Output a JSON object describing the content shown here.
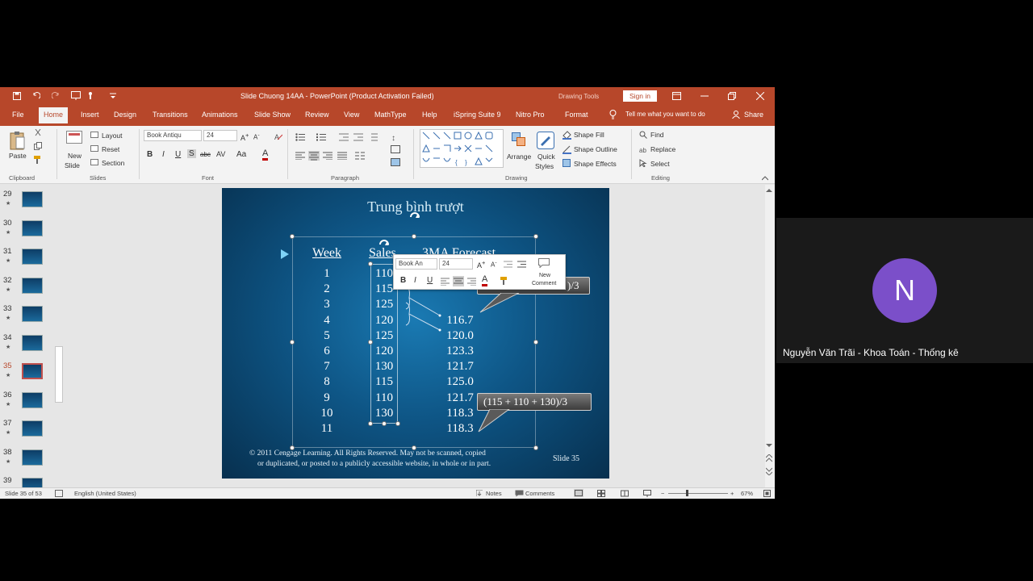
{
  "titlebar": {
    "title": "Slide Chuong 14AA  -  PowerPoint (Product Activation Failed)",
    "drawing_tools": "Drawing Tools",
    "sign_in": "Sign in"
  },
  "tabs": [
    "File",
    "Home",
    "Insert",
    "Design",
    "Transitions",
    "Animations",
    "Slide Show",
    "Review",
    "View",
    "MathType",
    "Help",
    "iSpring Suite 9",
    "Nitro Pro",
    "Format"
  ],
  "tell_me": "Tell me what you want to do",
  "share": "Share",
  "ribbon": {
    "clipboard": {
      "paste": "Paste",
      "label": "Clipboard"
    },
    "slides": {
      "new_slide": "New",
      "new_slide2": "Slide",
      "layout": "Layout",
      "reset": "Reset",
      "section": "Section",
      "label": "Slides"
    },
    "font": {
      "family": "Book Antiqu",
      "size": "24",
      "bold": "B",
      "italic": "I",
      "underline": "U",
      "shadow": "S",
      "strike": "abc",
      "spacing": "AV",
      "case": "Aa",
      "color": "A",
      "label": "Font"
    },
    "paragraph": {
      "label": "Paragraph"
    },
    "drawing": {
      "arrange": "Arrange",
      "quick_styles": "Quick",
      "quick_styles2": "Styles",
      "shape_fill": "Shape Fill",
      "shape_outline": "Shape Outline",
      "shape_effects": "Shape Effects",
      "label": "Drawing"
    },
    "editing": {
      "find": "Find",
      "replace": "Replace",
      "select": "Select",
      "label": "Editing"
    }
  },
  "thumbnails": [
    {
      "num": "29",
      "star": "★"
    },
    {
      "num": "30",
      "star": "★"
    },
    {
      "num": "31",
      "star": "★"
    },
    {
      "num": "32",
      "star": "★"
    },
    {
      "num": "33",
      "star": "★"
    },
    {
      "num": "34",
      "star": "★"
    },
    {
      "num": "35",
      "star": "★"
    },
    {
      "num": "36",
      "star": "★"
    },
    {
      "num": "37",
      "star": "★"
    },
    {
      "num": "38",
      "star": "★"
    },
    {
      "num": "39",
      "star": ""
    }
  ],
  "slide": {
    "title": "Trung bình trượt",
    "col_week": "Week",
    "col_sales": "Sales",
    "col_forecast": "3MA Forecast",
    "weeks": [
      "1",
      "2",
      "3",
      "4",
      "5",
      "6",
      "7",
      "8",
      "9",
      "10",
      "11"
    ],
    "sales": [
      "110",
      "115",
      "125",
      "120",
      "125",
      "120",
      "130",
      "115",
      "110",
      "130",
      ""
    ],
    "forecast": [
      "",
      "",
      "",
      "116.7",
      "120.0",
      "123.3",
      "121.7",
      "125.0",
      "121.7",
      "118.3",
      "118.3"
    ],
    "callout_top": ")/3",
    "callout_bottom": "(115 + 110 + 130)/3",
    "footer_line1": "© 2011  Cengage Learning.  All Rights Reserved.  May not be scanned, copied",
    "footer_line2": "or duplicated, or posted to a publicly accessible website, in whole or in part.",
    "slide_no": "Slide  35"
  },
  "mini_toolbar": {
    "font": "Book An",
    "size": "24",
    "bold": "B",
    "italic": "I",
    "underline": "U",
    "new_comment1": "New",
    "new_comment2": "Comment"
  },
  "status": {
    "slide_of": "Slide 35 of 53",
    "language": "English (United States)",
    "notes": "Notes",
    "comments": "Comments",
    "zoom": "67%"
  },
  "participant": {
    "initial": "N",
    "name": "Nguyễn Văn Trãi - Khoa Toán - Thống kê",
    "avatar_color": "#7b4fc9"
  }
}
